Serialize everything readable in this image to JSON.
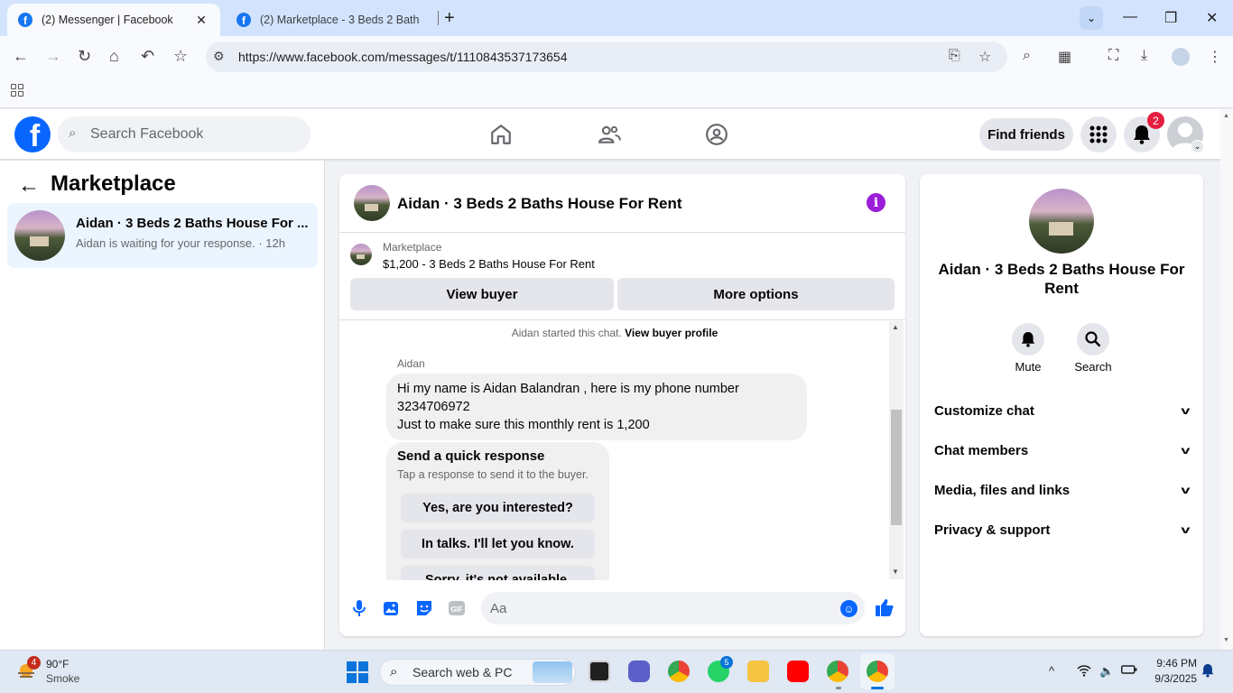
{
  "browser": {
    "tabs": [
      {
        "label": "(2) Messenger | Facebook",
        "active": true
      },
      {
        "label": "(2) Marketplace - 3 Beds 2 Bath",
        "active": false
      }
    ],
    "url": "https://www.facebook.com/messages/t/1110843537173654"
  },
  "fb": {
    "search_placeholder": "Search Facebook",
    "find_friends": "Find friends",
    "notification_count": "2"
  },
  "left": {
    "title": "Marketplace",
    "conversation": {
      "name": "Aidan · 3 Beds 2 Baths House For ...",
      "subtitle": "Aidan is waiting for your response. · 12h"
    }
  },
  "chat": {
    "title": "Aidan · 3 Beds 2 Baths House For Rent",
    "listing_category": "Marketplace",
    "listing_price_title": "$1,200 - 3 Beds 2 Baths House For Rent",
    "view_buyer": "View buyer",
    "more_options": "More options",
    "started_text": "Aidan started this chat.",
    "view_buyer_profile": "View buyer profile",
    "sender": "Aidan",
    "message_lines": [
      "Hi my name is Aidan Balandran , here is my phone number",
      "3234706972",
      "Just to make sure this monthly rent is 1,200"
    ],
    "quick_response": {
      "title": "Send a quick response",
      "subtitle": "Tap a response to send it to the buyer.",
      "options": [
        "Yes, are you interested?",
        "In talks. I'll let you know.",
        "Sorry, it's not available."
      ]
    },
    "composer_placeholder": "Aa"
  },
  "right": {
    "name": "Aidan · 3 Beds 2 Baths House For Rent",
    "actions": [
      "Mute",
      "Search"
    ],
    "rows": [
      "Customize chat",
      "Chat members",
      "Media, files and links",
      "Privacy & support"
    ]
  },
  "taskbar": {
    "weather_temp": "90°F",
    "weather_desc": "Smoke",
    "weather_badge": "4",
    "search_placeholder": "Search web & PC",
    "whatsapp_badge": "5",
    "time": "9:46 PM",
    "date": "9/3/2025"
  },
  "colors": {
    "fb_blue": "#0866ff",
    "info_purple": "#9c1dd8",
    "notif_red": "#e41e3f",
    "selected_bg": "#ebf5ff"
  }
}
